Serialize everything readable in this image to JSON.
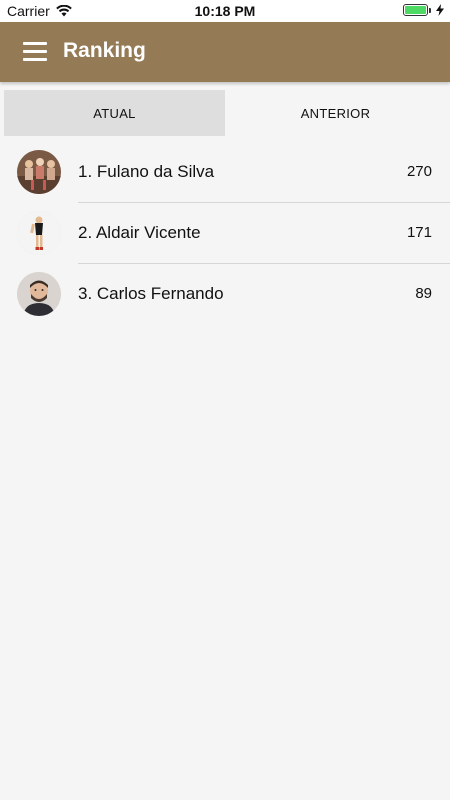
{
  "status_bar": {
    "carrier": "Carrier",
    "time": "10:18 PM",
    "icons": [
      "wifi-icon",
      "battery-icon",
      "charging-bolt-icon"
    ]
  },
  "app_bar": {
    "title": "Ranking",
    "background_color": "#957a56",
    "menu_icon": "hamburger-menu-icon"
  },
  "tabs": [
    {
      "label": "ATUAL",
      "active": true
    },
    {
      "label": "ANTERIOR",
      "active": false
    }
  ],
  "ranking": [
    {
      "label": "1. Fulano da Silva",
      "score": "270",
      "avatar": "group-photo-avatar"
    },
    {
      "label": "2. Aldair Vicente",
      "score": "171",
      "avatar": "runner-photo-avatar"
    },
    {
      "label": "3. Carlos Fernando",
      "score": "89",
      "avatar": "man-portrait-avatar"
    }
  ]
}
